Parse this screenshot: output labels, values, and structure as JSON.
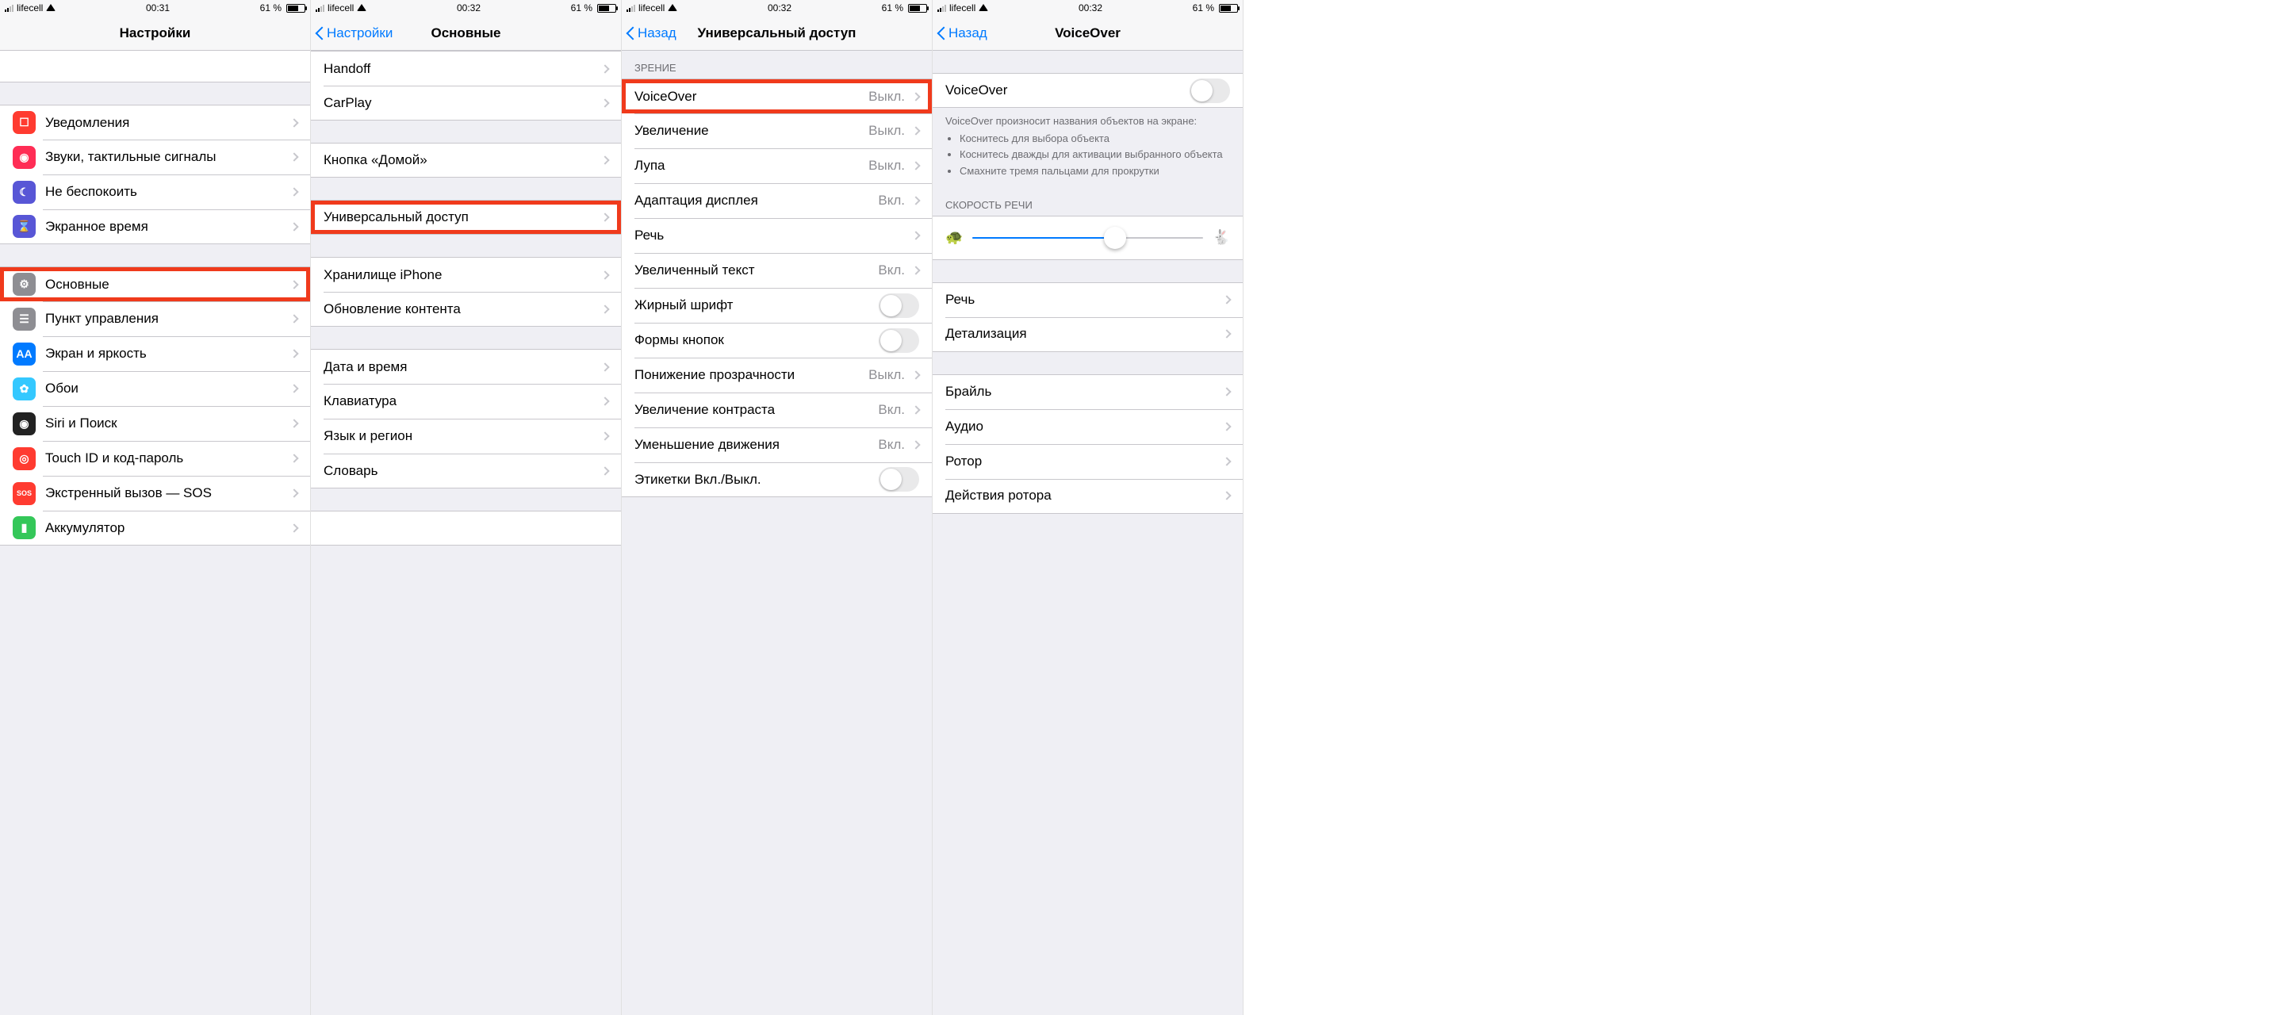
{
  "status": {
    "carrier": "lifecell",
    "battery_pct": "61 %"
  },
  "col1": {
    "time": "00:31",
    "title": "Настройки",
    "group1": [
      {
        "icon_bg": "#ff3b30",
        "icon": "bell-icon",
        "glyph": "☐",
        "label": "Уведомления"
      },
      {
        "icon_bg": "#ff2d55",
        "icon": "sound-icon",
        "glyph": "◉",
        "label": "Звуки, тактильные сигналы"
      },
      {
        "icon_bg": "#5856d6",
        "icon": "moon-icon",
        "glyph": "☾",
        "label": "Не беспокоить"
      },
      {
        "icon_bg": "#5856d6",
        "icon": "hourglass-icon",
        "glyph": "⌛",
        "label": "Экранное время"
      }
    ],
    "group2": [
      {
        "icon_bg": "#8e8e93",
        "icon": "gear-icon",
        "glyph": "⚙",
        "label": "Основные",
        "hl": true
      },
      {
        "icon_bg": "#8e8e93",
        "icon": "control-center-icon",
        "glyph": "☰",
        "label": "Пункт управления"
      },
      {
        "icon_bg": "#007aff",
        "icon": "display-icon",
        "glyph": "AA",
        "label": "Экран и яркость"
      },
      {
        "icon_bg": "#34c8ff",
        "icon": "wallpaper-icon",
        "glyph": "✿",
        "label": "Обои"
      },
      {
        "icon_bg": "#222",
        "icon": "siri-icon",
        "glyph": "◉",
        "label": "Siri и Поиск"
      },
      {
        "icon_bg": "#ff3b30",
        "icon": "touchid-icon",
        "glyph": "◎",
        "label": "Touch ID и код-пароль"
      },
      {
        "icon_bg": "#ff3b30",
        "icon": "sos-icon",
        "glyph": "SOS",
        "label": "Экстренный вызов — SOS"
      },
      {
        "icon_bg": "#34c759",
        "icon": "battery-icon",
        "glyph": "▮",
        "label": "Аккумулятор"
      }
    ]
  },
  "col2": {
    "time": "00:32",
    "back": "Настройки",
    "title": "Основные",
    "group1": [
      {
        "label": "Handoff"
      },
      {
        "label": "CarPlay"
      }
    ],
    "group2": [
      {
        "label": "Кнопка «Домой»"
      }
    ],
    "group3": [
      {
        "label": "Универсальный доступ",
        "hl": true
      }
    ],
    "group4": [
      {
        "label": "Хранилище iPhone"
      },
      {
        "label": "Обновление контента"
      }
    ],
    "group5": [
      {
        "label": "Дата и время"
      },
      {
        "label": "Клавиатура"
      },
      {
        "label": "Язык и регион"
      },
      {
        "label": "Словарь"
      }
    ]
  },
  "col3": {
    "time": "00:32",
    "back": "Назад",
    "title": "Универсальный доступ",
    "header_vision": "ЗРЕНИЕ",
    "rows": [
      {
        "label": "VoiceOver",
        "val": "Выкл.",
        "chev": true,
        "hl": true
      },
      {
        "label": "Увеличение",
        "val": "Выкл.",
        "chev": true
      },
      {
        "label": "Лупа",
        "val": "Выкл.",
        "chev": true
      },
      {
        "label": "Адаптация дисплея",
        "val": "Вкл.",
        "chev": true
      },
      {
        "label": "Речь",
        "chev": true
      },
      {
        "label": "Увеличенный текст",
        "val": "Вкл.",
        "chev": true
      },
      {
        "label": "Жирный шрифт",
        "toggle": false
      },
      {
        "label": "Формы кнопок",
        "toggle": false
      },
      {
        "label": "Понижение прозрачности",
        "val": "Выкл.",
        "chev": true
      },
      {
        "label": "Увеличение контраста",
        "val": "Вкл.",
        "chev": true
      },
      {
        "label": "Уменьшение движения",
        "val": "Вкл.",
        "chev": true
      },
      {
        "label": "Этикетки Вкл./Выкл.",
        "toggle": false
      }
    ]
  },
  "col4": {
    "time": "00:32",
    "back": "Назад",
    "title": "VoiceOver",
    "main_label": "VoiceOver",
    "footer_title": "VoiceOver произносит названия объектов на экране:",
    "footer_items": [
      "Коснитесь для выбора объекта",
      "Коснитесь дважды для активации выбранного объекта",
      "Смахните тремя пальцами для прокрутки"
    ],
    "speed_header": "СКОРОСТЬ РЕЧИ",
    "group2": [
      {
        "label": "Речь"
      },
      {
        "label": "Детализация"
      }
    ],
    "group3": [
      {
        "label": "Брайль"
      },
      {
        "label": "Аудио"
      },
      {
        "label": "Ротор"
      },
      {
        "label": "Действия ротора"
      }
    ]
  }
}
